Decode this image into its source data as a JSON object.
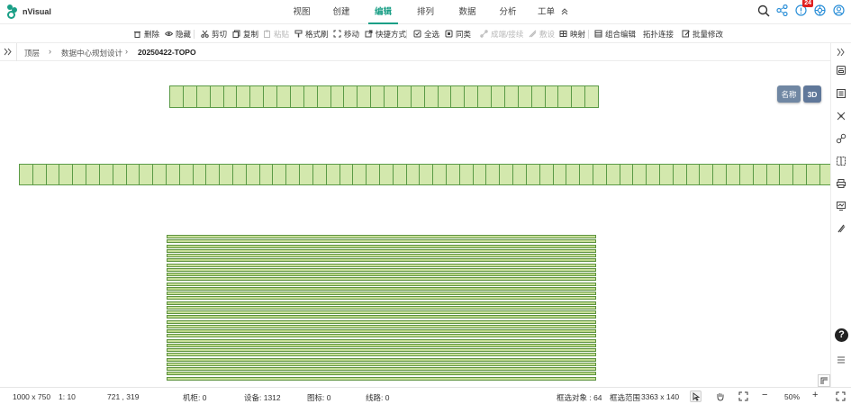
{
  "app": {
    "name": "nVisual",
    "brand_color": "#1a9f86"
  },
  "nav": {
    "tabs": [
      {
        "label": "视图",
        "active": false
      },
      {
        "label": "创建",
        "active": false
      },
      {
        "label": "编辑",
        "active": true
      },
      {
        "label": "排列",
        "active": false
      },
      {
        "label": "数据",
        "active": false
      },
      {
        "label": "分析",
        "active": false
      },
      {
        "label": "工单",
        "active": false
      }
    ],
    "notification_count": "24",
    "icons": [
      "search-icon",
      "share-icon",
      "notification-icon",
      "settings-icon",
      "user-icon"
    ]
  },
  "toolbar": {
    "items": [
      {
        "label": "删除",
        "icon": "trash-icon",
        "enabled": true
      },
      {
        "label": "隐藏",
        "icon": "eye-icon",
        "enabled": true
      },
      {
        "label": "剪切",
        "icon": "scissors-icon",
        "enabled": true
      },
      {
        "label": "复制",
        "icon": "copy-icon",
        "enabled": true
      },
      {
        "label": "粘贴",
        "icon": "paste-icon",
        "enabled": false
      },
      {
        "label": "格式刷",
        "icon": "brush-icon",
        "enabled": true
      },
      {
        "label": "移动",
        "icon": "move-icon",
        "enabled": true
      },
      {
        "label": "快捷方式",
        "icon": "shortcut-icon",
        "enabled": true
      },
      {
        "label": "全选",
        "icon": "select-all-icon",
        "enabled": true
      },
      {
        "label": "同类",
        "icon": "same-type-icon",
        "enabled": true
      },
      {
        "label": "成端/接续",
        "icon": "connect-icon",
        "enabled": false
      },
      {
        "label": "敷设",
        "icon": "lay-icon",
        "enabled": false
      },
      {
        "label": "映射",
        "icon": "map-icon",
        "enabled": true
      },
      {
        "label": "组合编辑",
        "icon": "group-edit-icon",
        "enabled": true
      },
      {
        "label": "拓扑连接",
        "icon": "",
        "enabled": true
      },
      {
        "label": "批量修改",
        "icon": "batch-edit-icon",
        "enabled": true
      }
    ]
  },
  "breadcrumb": {
    "items": [
      "顶层",
      "数据中心规划设计",
      "20250422-TOPO"
    ]
  },
  "canvas": {
    "view_buttons": {
      "name": "名称",
      "three_d": "3D"
    },
    "rack_color": "#d3e8ad",
    "rack_border_color": "#5a9a46",
    "rows": [
      {
        "count": 32
      },
      {
        "count": 61
      }
    ],
    "stack_strips": 31
  },
  "status": {
    "canvas_size": "1000 x 750",
    "scale": "1: 10",
    "cursor": "721 , 319",
    "cabinet_label": "机柜: 0",
    "device_label": "设备: 1312",
    "marker_label": "图标: 0",
    "line_label": "线路: 0",
    "selected_label": "框选对象 : 64",
    "range_label": "框选范围",
    "range_value": "3363 x 140",
    "zoom_out": "−",
    "zoom": "50%",
    "zoom_in": "+"
  },
  "help": {
    "label": "?"
  }
}
